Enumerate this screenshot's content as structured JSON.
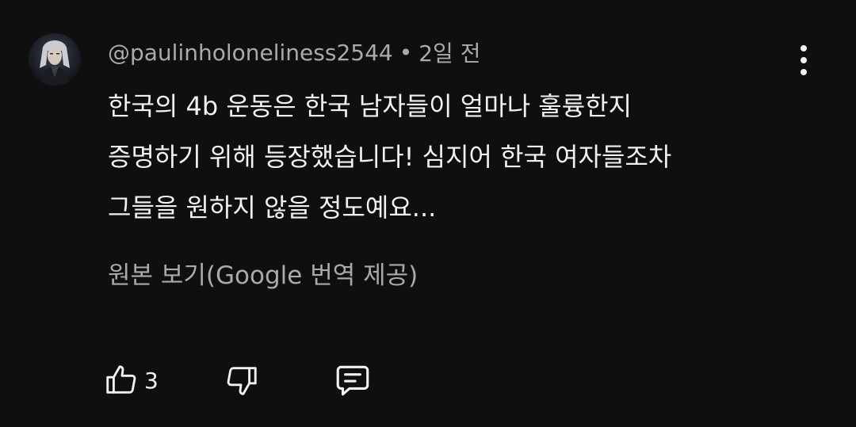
{
  "comment": {
    "author": "@paulinholoneliness2544",
    "separator": "•",
    "time": "2일 전",
    "text_lines": [
      "한국의 4b 운동은 한국 남자들이 얼마나 훌륭한지",
      "증명하기 위해 등장했습니다! 심지어 한국 여자들조차",
      "그들을 원하지 않을 정도예요..."
    ],
    "translation_link": "원본 보기(Google 번역 제공)",
    "like_count": "3"
  },
  "icons": {
    "avatar": "avatar-portrait",
    "menu": "more-vert-icon",
    "like": "thumb-up-icon",
    "dislike": "thumb-down-icon",
    "reply": "comment-icon"
  },
  "colors": {
    "background": "#0f0f0f",
    "primary_text": "#f1f1f1",
    "secondary_text": "#aaaaaa"
  }
}
